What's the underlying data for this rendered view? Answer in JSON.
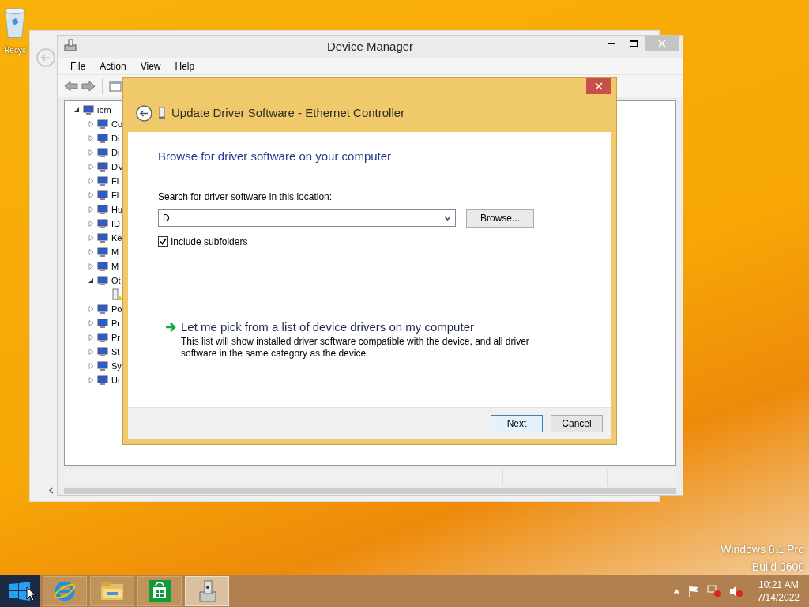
{
  "desktop": {
    "recycle_bin_label": "Recyc",
    "watermark": [
      "Windows 8.1 Pro",
      "Build 9600"
    ]
  },
  "device_manager": {
    "title": "Device Manager",
    "menu": [
      "File",
      "Action",
      "View",
      "Help"
    ],
    "tree": [
      {
        "label": "ibm",
        "expanded": true,
        "children": [
          {
            "label": "Co",
            "expanded": false
          },
          {
            "label": "Di",
            "expanded": false
          },
          {
            "label": "Di",
            "expanded": false
          },
          {
            "label": "DV",
            "expanded": false
          },
          {
            "label": "Fl",
            "expanded": false
          },
          {
            "label": "Fl",
            "expanded": false
          },
          {
            "label": "Hu",
            "expanded": false
          },
          {
            "label": "ID",
            "expanded": false
          },
          {
            "label": "Ke",
            "expanded": false
          },
          {
            "label": "M",
            "expanded": false
          },
          {
            "label": "M",
            "expanded": false
          },
          {
            "label": "Ot",
            "expanded": true,
            "children": [
              {
                "kind": "warning-device"
              }
            ]
          },
          {
            "label": "Po",
            "expanded": false
          },
          {
            "label": "Pr",
            "expanded": false
          },
          {
            "label": "Pr",
            "expanded": false
          },
          {
            "label": "St",
            "expanded": false
          },
          {
            "label": "Sy",
            "expanded": false
          },
          {
            "label": "Ur",
            "expanded": false
          }
        ]
      }
    ]
  },
  "dialog": {
    "title": "Update Driver Software - Ethernet Controller",
    "heading": "Browse for driver software on your computer",
    "location_label": "Search for driver software in this location:",
    "location_value": "D",
    "browse_button": "Browse...",
    "include_subfolders": {
      "label": "Include subfolders",
      "checked": true
    },
    "pick_link": "Let me pick from a list of device drivers on my computer",
    "pick_description": "This list will show installed driver software compatible with the device, and all driver software in the same category as the device.",
    "buttons": [
      {
        "label": "Next",
        "default": true
      },
      {
        "label": "Cancel",
        "default": false
      }
    ]
  },
  "taskbar": {
    "apps": [
      {
        "kind": "ie",
        "active": false
      },
      {
        "kind": "explorer",
        "active": false
      },
      {
        "kind": "store",
        "active": false
      },
      {
        "kind": "devmgr",
        "active": true
      }
    ],
    "time": "10:21 AM",
    "date": "7/14/2022"
  }
}
